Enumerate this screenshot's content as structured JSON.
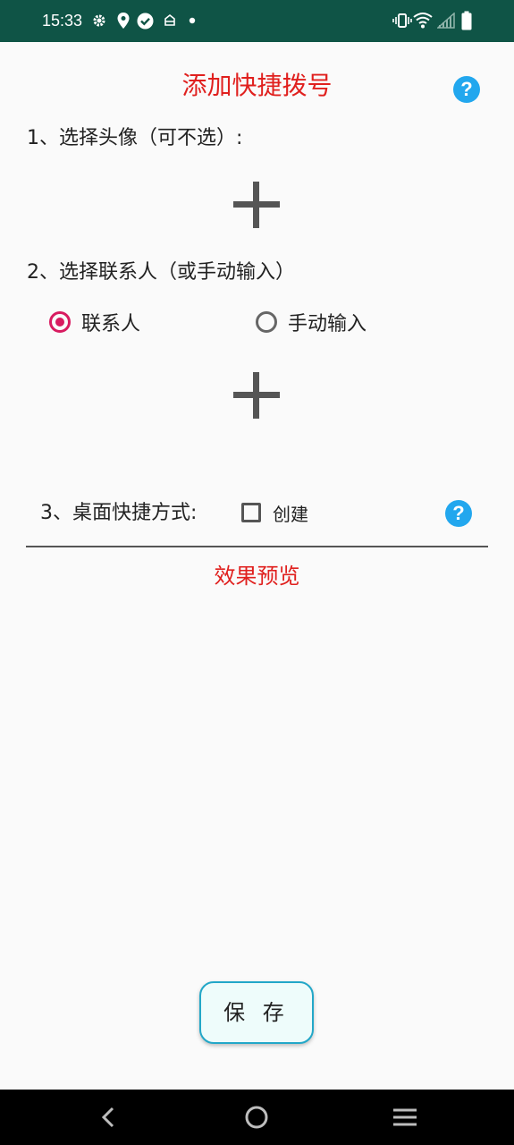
{
  "status_bar": {
    "time": "15:33"
  },
  "header": {
    "title": "添加快捷拨号"
  },
  "step1": {
    "label": "1、选择头像（可不选）:"
  },
  "step2": {
    "label": "2、选择联系人（或手动输入）",
    "options": [
      {
        "label": "联系人",
        "selected": true
      },
      {
        "label": "手动输入",
        "selected": false
      }
    ]
  },
  "step3": {
    "label": "3、桌面快捷方式:",
    "checkbox_label": "创建",
    "checked": false
  },
  "preview": {
    "label": "效果预览"
  },
  "actions": {
    "save_label": "保 存"
  },
  "colors": {
    "status_bar": "#0f5446",
    "accent_red": "#e0201e",
    "help_blue": "#22a7ee",
    "radio_pink": "#d81b60"
  },
  "icons": {
    "help": "question-circle-icon",
    "add": "plus-icon"
  }
}
